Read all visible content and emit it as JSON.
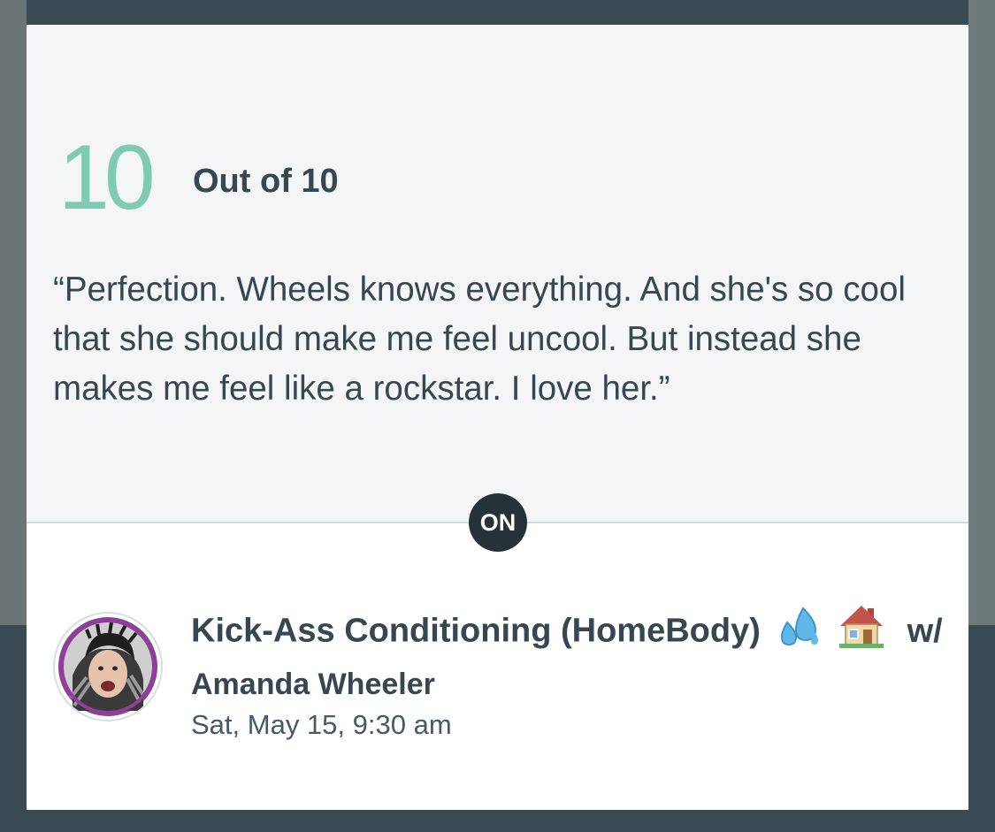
{
  "review": {
    "score": "10",
    "score_suffix": "Out of 10",
    "quote": "“Perfection. Wheels knows everything. And she's so cool that she should make me feel uncool. But instead she makes me feel like a rockstar. I love her.”"
  },
  "divider_badge": "ON",
  "class_info": {
    "title": "Kick-Ass Conditioning (HomeBody)",
    "title_icons": [
      "sweat-droplets-emoji",
      "house-emoji"
    ],
    "with_label": "w/",
    "instructor": "Amanda Wheeler",
    "date": "Sat, May 15, 9:30 am"
  },
  "colors": {
    "score_accent": "#7ecbb2",
    "text_dark": "#37474f",
    "badge_bg": "#263238",
    "backdrop_dark": "#3a4a52",
    "card_upper_bg": "#f3f5f7"
  }
}
